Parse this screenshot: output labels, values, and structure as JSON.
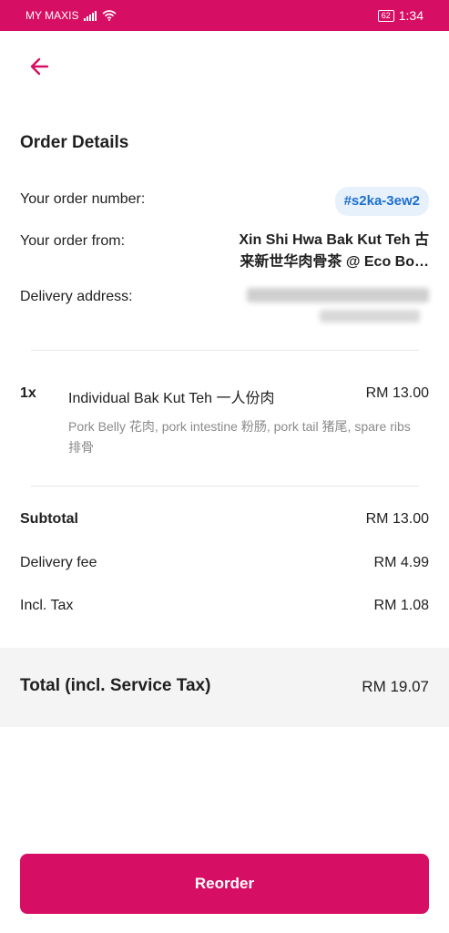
{
  "status_bar": {
    "carrier": "MY MAXIS",
    "battery": "62",
    "time": "1:34"
  },
  "header": {
    "back_icon": "arrow-left-icon",
    "accent_color": "#d70f64"
  },
  "order_details": {
    "title": "Order Details",
    "order_number_label": "Your order number:",
    "order_number": "#s2ka-3ew2",
    "order_from_label": "Your order from:",
    "restaurant_line1": "Xin Shi Hwa Bak Kut Teh 古",
    "restaurant_line2": "来新世华肉骨茶 @ Eco Bo…",
    "delivery_address_label": "Delivery address:"
  },
  "items": [
    {
      "qty": "1x",
      "name": "Individual Bak Kut Teh 一人份肉",
      "price": "RM 13.00",
      "description": "Pork Belly 花肉, pork intestine 粉肠, pork tail 猪尾, spare ribs 排骨"
    }
  ],
  "summary": {
    "subtotal_label": "Subtotal",
    "subtotal_value": "RM 13.00",
    "delivery_fee_label": "Delivery fee",
    "delivery_fee_value": "RM 4.99",
    "tax_label": "Incl. Tax",
    "tax_value": "RM 1.08",
    "total_label": "Total (incl. Service Tax)",
    "total_value": "RM 19.07"
  },
  "actions": {
    "reorder_label": "Reorder"
  }
}
